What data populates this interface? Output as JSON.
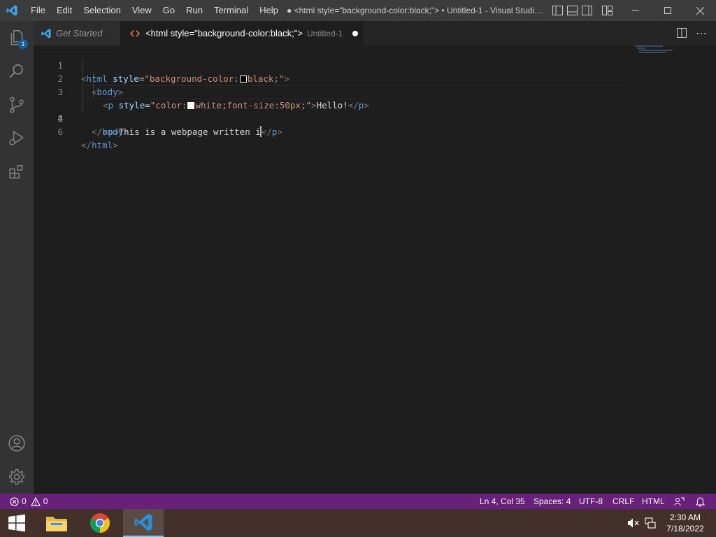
{
  "titlebar": {
    "menu": [
      "File",
      "Edit",
      "Selection",
      "View",
      "Go",
      "Run",
      "Terminal",
      "Help"
    ],
    "window_title": "● <html style=\"background-color:black;\"> • Untitled-1 - Visual Studio Code"
  },
  "activitybar": {
    "explorer_badge": "1"
  },
  "tabs": {
    "get_started": "Get Started",
    "untitled_label": "<html style=\"background-color:black;\">",
    "untitled_desc": "Untitled-1"
  },
  "editor": {
    "line_numbers": [
      "1",
      "2",
      "3",
      "4",
      "5",
      "6"
    ],
    "lines": {
      "l1": {
        "open": "<",
        "tag": "html",
        "sp": " ",
        "attr": "style",
        "eq": "=",
        "q1": "\"",
        "val1": "background-color:",
        "val2": "black;",
        "q2": "\"",
        "close": ">"
      },
      "l2": {
        "open": "<",
        "tag": "body",
        "close": ">"
      },
      "l3": {
        "open": "<",
        "tag": "p",
        "sp": " ",
        "attr": "style",
        "eq": "=",
        "q1": "\"",
        "val1": "color:",
        "val2": "white;font-size:50px;",
        "q2": "\"",
        "close": ">",
        "text": "Hello!",
        "end_open": "</",
        "end_tag": "p",
        "end_close": ">"
      },
      "l4": {
        "open": "<",
        "tag": "p",
        "close": ">",
        "text": "This is a webpage written i",
        "end_open": "</",
        "end_tag": "p",
        "end_close": ">"
      },
      "l5": {
        "open": "</",
        "tag": "body",
        "close": ">"
      },
      "l6": {
        "open": "</",
        "tag": "html",
        "close": ">"
      }
    }
  },
  "statusbar": {
    "errors": "0",
    "warnings": "0",
    "position": "Ln 4, Col 35",
    "spaces": "Spaces: 4",
    "encoding": "UTF-8",
    "eol": "CRLF",
    "language": "HTML"
  },
  "taskbar": {
    "time": "2:30 AM",
    "date": "7/18/2022"
  },
  "colors": {
    "statusbar_bg": "#68217a",
    "titlebar_bg": "#3c3c3c",
    "editor_bg": "#1e1e1e",
    "tag_blue": "#569cd6",
    "attr_light_blue": "#9cdcfe",
    "string_orange": "#ce9178"
  }
}
